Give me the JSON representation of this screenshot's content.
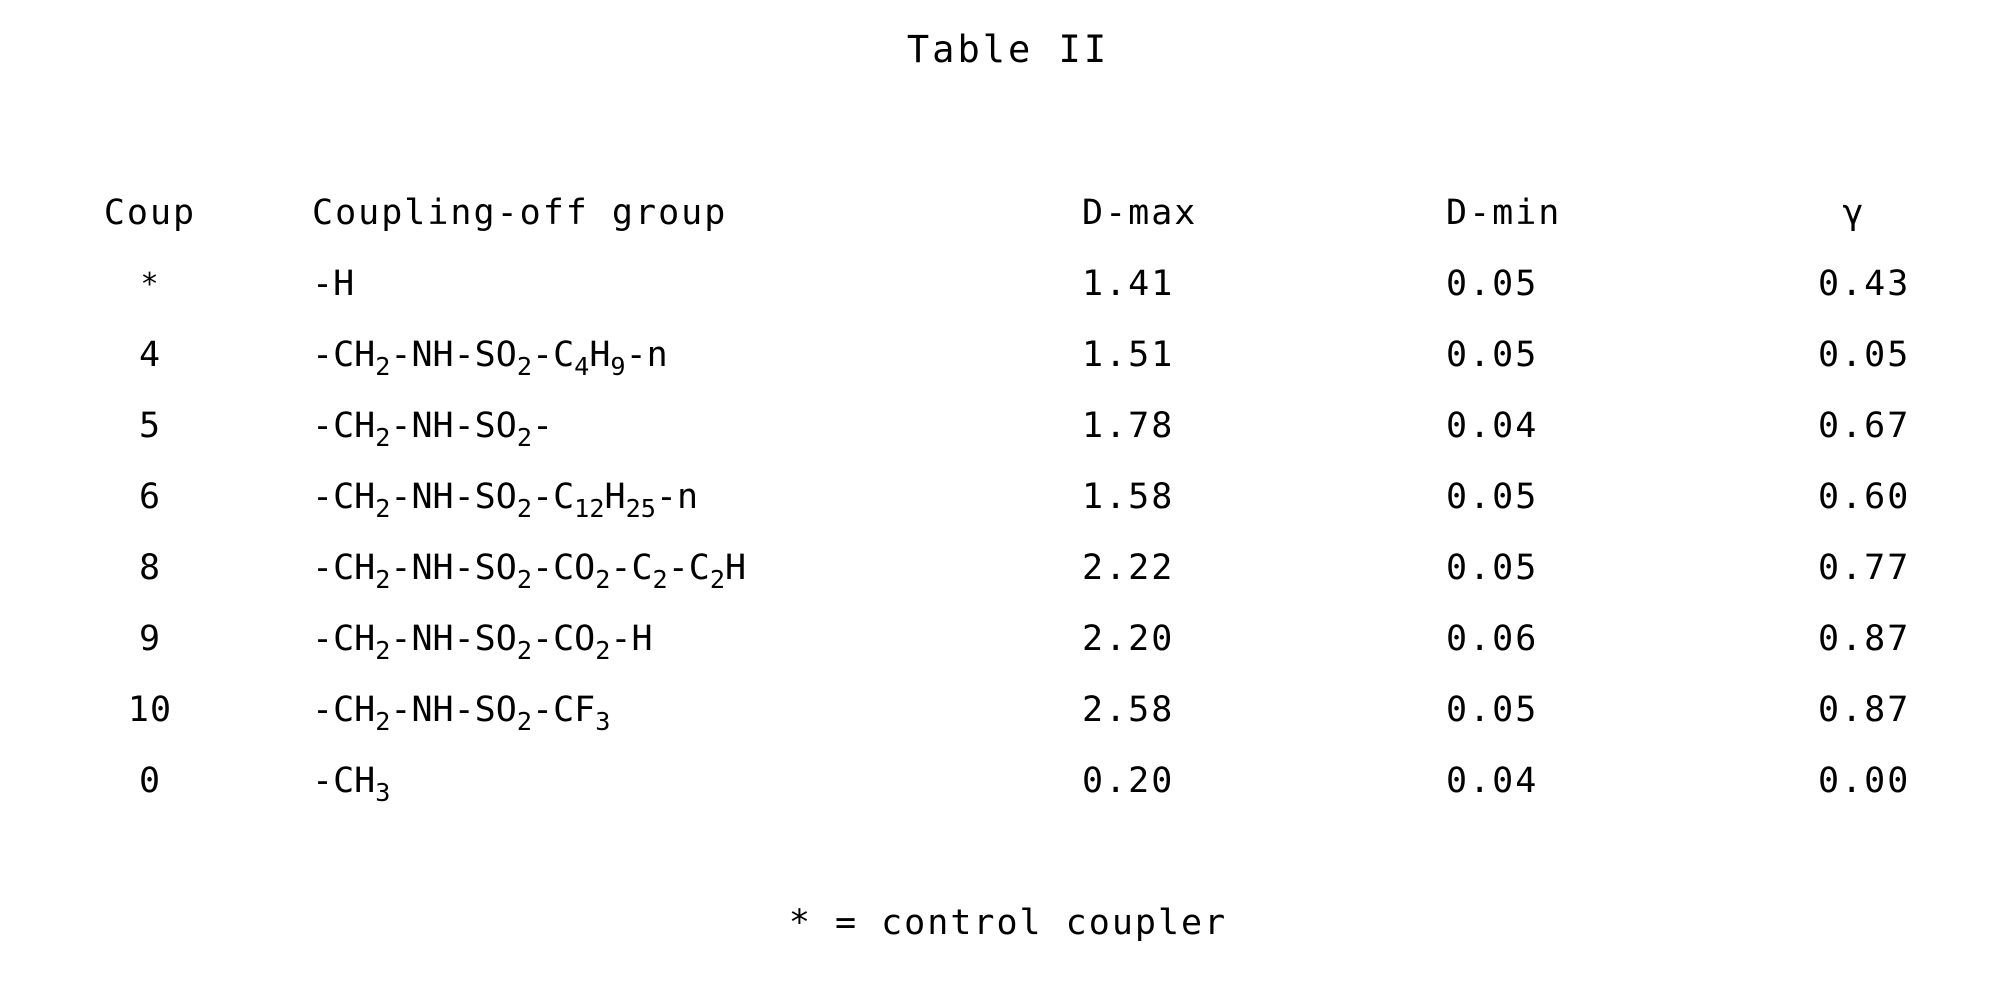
{
  "document": {
    "title": "Table II",
    "footnote": "* = control coupler"
  },
  "table": {
    "headers": {
      "coup": "Coup",
      "group": "Coupling-off group",
      "dmax": "D-max",
      "dmin": "D-min",
      "gamma": "γ"
    },
    "rows": [
      {
        "coup": "*",
        "group_plain": "-H",
        "group_html": "-H",
        "dmax": "1.41",
        "dmin": "0.05",
        "gamma": "0.43"
      },
      {
        "coup": "4",
        "group_plain": "-CH2-NH-SO2-C4H9-n",
        "group_html": "-CH<sub>2</sub>-NH-SO<sub>2</sub>-C<sub>4</sub>H<sub>9</sub>-n",
        "dmax": "1.51",
        "dmin": "0.05",
        "gamma": "0.05"
      },
      {
        "coup": "5",
        "group_plain": "-CH2-NH-SO2-",
        "group_html": "-CH<sub>2</sub>-NH-SO<sub>2</sub>-",
        "dmax": "1.78",
        "dmin": "0.04",
        "gamma": "0.67"
      },
      {
        "coup": "6",
        "group_plain": "-CH2-NH-SO2-C12H25-n",
        "group_html": "-CH<sub>2</sub>-NH-SO<sub>2</sub>-C<sub>12</sub>H<sub>25</sub>-n",
        "dmax": "1.58",
        "dmin": "0.05",
        "gamma": "0.60"
      },
      {
        "coup": "8",
        "group_plain": "-CH2-NH-SO2-CO2-C2-C2H",
        "group_html": "-CH<sub>2</sub>-NH-SO<sub>2</sub>-CO<sub>2</sub>-C<sub>2</sub>-C<sub>2</sub>H",
        "dmax": "2.22",
        "dmin": "0.05",
        "gamma": "0.77"
      },
      {
        "coup": "9",
        "group_plain": "-CH2-NH-SO2-CO2-H",
        "group_html": "-CH<sub>2</sub>-NH-SO<sub>2</sub>-CO<sub>2</sub>-H",
        "dmax": "2.20",
        "dmin": "0.06",
        "gamma": "0.87"
      },
      {
        "coup": "10",
        "group_plain": "-CH2-NH-SO2-CF3",
        "group_html": "-CH<sub>2</sub>-NH-SO<sub>2</sub>-CF<sub>3</sub>",
        "dmax": "2.58",
        "dmin": "0.05",
        "gamma": "0.87"
      },
      {
        "coup": "0",
        "group_plain": "-CH3",
        "group_html": "-CH<sub>3</sub>",
        "dmax": "0.20",
        "dmin": "0.04",
        "gamma": "0.00"
      }
    ]
  }
}
